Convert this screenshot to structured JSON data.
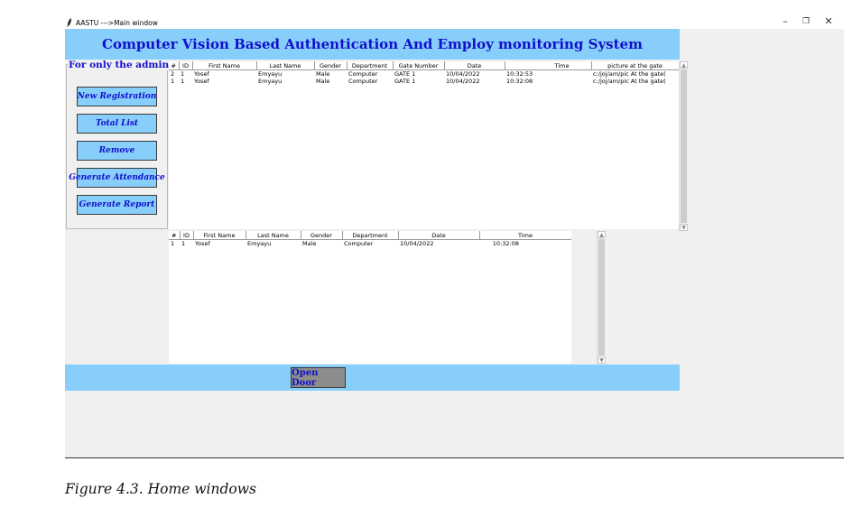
{
  "window": {
    "title": "AASTU --->Main window",
    "icon": "feather-icon",
    "controls": {
      "minimize": "–",
      "restore": "❐",
      "close": "✕"
    }
  },
  "header": {
    "title": "Computer Vision Based Authentication And Employ monitoring System"
  },
  "admin_panel": {
    "legend": "For only the admins",
    "buttons": [
      {
        "label": "New Registration"
      },
      {
        "label": "Total List"
      },
      {
        "label": "Remove"
      },
      {
        "label": "Generate Attendance"
      },
      {
        "label": "Generate Report"
      }
    ]
  },
  "gate_table": {
    "columns": [
      "#",
      "ID",
      "First Name",
      "Last Name",
      "Gender",
      "Department",
      "Gate Number",
      "Date",
      "Time",
      "picture at the gate"
    ],
    "rows": [
      [
        "2",
        "1",
        "Yosef",
        "Emyayu",
        "Male",
        "Computer",
        "GATE 1",
        "10/04/2022",
        "10:32:53",
        "c:/joj/am/pic At the gate("
      ],
      [
        "1",
        "1",
        "Yosef",
        "Emyayu",
        "Male",
        "Computer",
        "GATE 1",
        "10/04/2022",
        "10:32:08",
        "c:/joj/am/pic At the gate("
      ]
    ]
  },
  "attendance_table": {
    "columns": [
      "#",
      "ID",
      "First Name",
      "Last Name",
      "Gender",
      "Department",
      "Date",
      "Time"
    ],
    "rows": [
      [
        "1",
        "1",
        "Yosef",
        "Emyayu",
        "Male",
        "Computer",
        "10/04/2022",
        "10:32:08"
      ]
    ]
  },
  "footer": {
    "open_door_label": "Open Door"
  },
  "caption": "Figure 4.3. Home windows",
  "colors": {
    "accent_band": "#87cefa",
    "title_text": "#1010cc",
    "window_bg": "#f0f0f0"
  }
}
